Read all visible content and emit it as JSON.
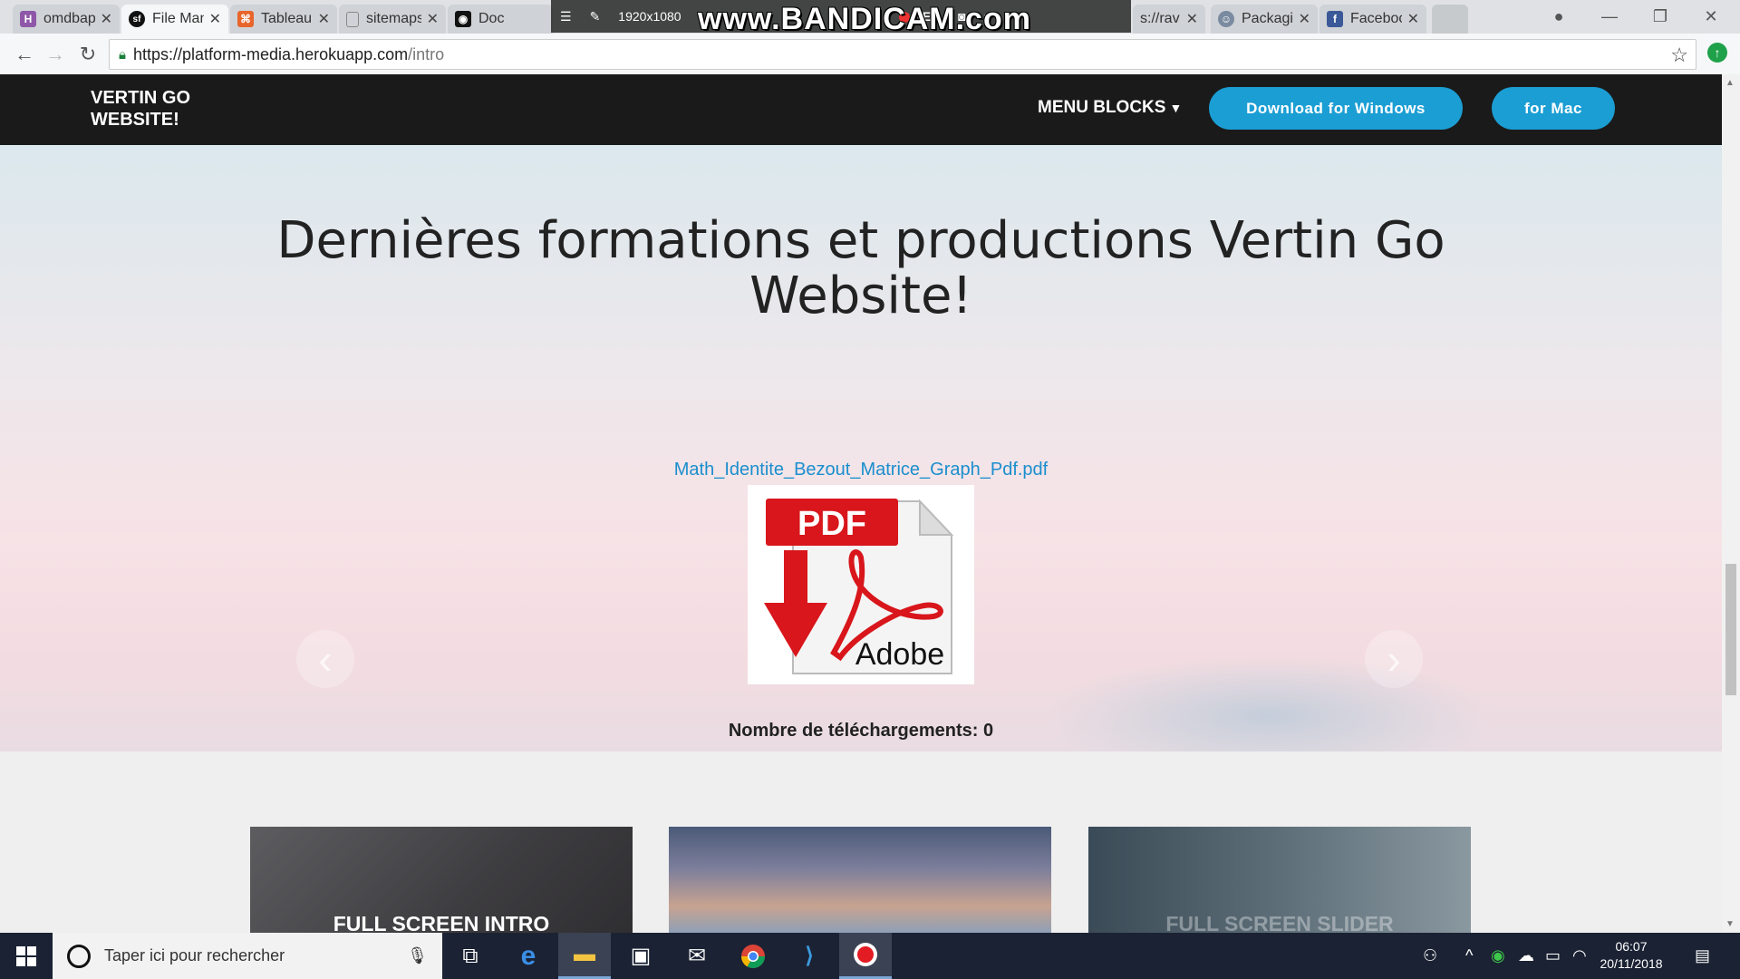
{
  "browser": {
    "tabs": [
      {
        "title": "omdbapi-a",
        "favicon_color": "#8e57a8",
        "favicon_glyph": "H"
      },
      {
        "title": "File Manag",
        "favicon_color": "#111111",
        "favicon_glyph": "sf",
        "active": true
      },
      {
        "title": "Tableau de",
        "favicon_color": "#e8652b",
        "favicon_glyph": "⌘"
      },
      {
        "title": "sitemaps.c",
        "favicon_color": "#888888",
        "favicon_glyph": "▯"
      },
      {
        "title": "Doc",
        "favicon_color": "#111111",
        "favicon_glyph": "◉"
      },
      {
        "title": "s://rav",
        "favicon_color": "#888888",
        "favicon_glyph": ""
      },
      {
        "title": "Packagist",
        "favicon_color": "#7a8aa0",
        "favicon_glyph": "☺"
      },
      {
        "title": "Facebook",
        "favicon_color": "#3b5998",
        "favicon_glyph": "f"
      }
    ],
    "url_host": "https://platform-media.herokuapp.com",
    "url_path": "/intro"
  },
  "bandicam": {
    "watermark": "www.BANDICAM.com",
    "resolution": "1920x1080",
    "rec": "REC"
  },
  "site": {
    "brand": "VERTIN GO WEBSITE!",
    "menu_label": "MENU BLOCKS",
    "btn_windows": "Download for Windows",
    "btn_mac": "for Mac",
    "hero_title": "Dernières formations et productions Vertin Go Website!",
    "file_name": "Math_Identite_Bezout_Matrice_Graph_Pdf.pdf",
    "pdf_label": "PDF",
    "pdf_brand": "Adobe",
    "downloads_label": "Nombre de téléchargements: 0",
    "cards": [
      {
        "label": "FULL SCREEN INTRO"
      },
      {
        "label": ""
      },
      {
        "label": "FULL SCREEN SLIDER"
      }
    ]
  },
  "taskbar": {
    "search_placeholder": "Taper ici pour rechercher",
    "time": "06:07",
    "date": "20/11/2018"
  },
  "colors": {
    "accent_button": "#1b9ed4",
    "link": "#1b8ecd",
    "navbar": "#1a1a1a",
    "taskbar": "#1b2233"
  }
}
